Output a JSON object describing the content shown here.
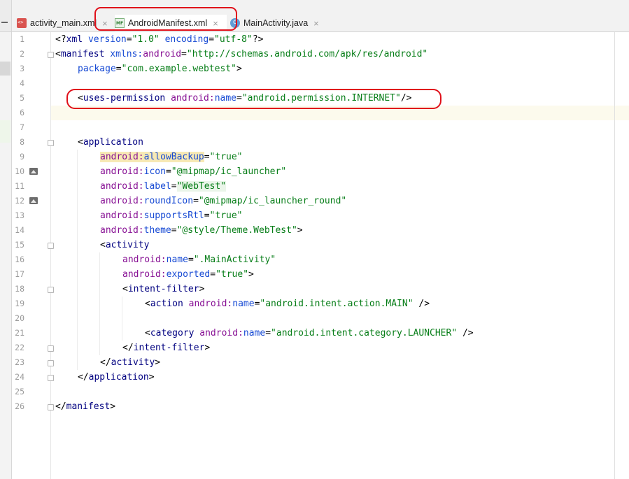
{
  "tabs": [
    {
      "label": "activity_main.xml",
      "icon": "xml-file-icon",
      "active": false
    },
    {
      "label": "AndroidManifest.xml",
      "icon": "manifest-file-icon",
      "active": true
    },
    {
      "label": "MainActivity.java",
      "icon": "java-class-icon",
      "active": false
    }
  ],
  "close_glyph": "×",
  "line_numbers": [
    "1",
    "2",
    "3",
    "4",
    "5",
    "6",
    "7",
    "8",
    "9",
    "10",
    "11",
    "12",
    "13",
    "14",
    "15",
    "16",
    "17",
    "18",
    "19",
    "20",
    "21",
    "22",
    "23",
    "24",
    "25",
    "26"
  ],
  "code": {
    "l1": {
      "a": "<?",
      "b": "xml",
      "c": " ",
      "d": "version",
      "e": "=",
      "f": "\"1.0\"",
      "g": " ",
      "h": "encoding",
      "i": "=",
      "j": "\"utf-8\"",
      "k": "?>"
    },
    "l2": {
      "a": "<",
      "b": "manifest",
      "c": " ",
      "d": "xmlns:",
      "e": "android",
      "f": "=",
      "g": "\"http://schemas.android.com/apk/res/android\""
    },
    "l3": {
      "a": "package",
      "b": "=",
      "c": "\"com.example.webtest\"",
      "d": ">"
    },
    "l5": {
      "a": "<",
      "b": "uses-permission",
      "c": " ",
      "d": "android:",
      "e": "name",
      "f": "=",
      "g": "\"android.permission.INTERNET\"",
      "h": "/>"
    },
    "l8": {
      "a": "<",
      "b": "application"
    },
    "l9": {
      "a": "android:",
      "b": "allowBackup",
      "c": "=",
      "d": "\"true\""
    },
    "l10": {
      "a": "android:",
      "b": "icon",
      "c": "=",
      "d": "\"@mipmap/ic_launcher\""
    },
    "l11": {
      "a": "android:",
      "b": "label",
      "c": "=",
      "d": "\"WebTest\""
    },
    "l12": {
      "a": "android:",
      "b": "roundIcon",
      "c": "=",
      "d": "\"@mipmap/ic_launcher_round\""
    },
    "l13": {
      "a": "android:",
      "b": "supportsRtl",
      "c": "=",
      "d": "\"true\""
    },
    "l14": {
      "a": "android:",
      "b": "theme",
      "c": "=",
      "d": "\"@style/Theme.WebTest\"",
      "e": ">"
    },
    "l15": {
      "a": "<",
      "b": "activity"
    },
    "l16": {
      "a": "android:",
      "b": "name",
      "c": "=",
      "d": "\".MainActivity\""
    },
    "l17": {
      "a": "android:",
      "b": "exported",
      "c": "=",
      "d": "\"true\"",
      "e": ">"
    },
    "l18": {
      "a": "<",
      "b": "intent-filter",
      "c": ">"
    },
    "l19": {
      "a": "<",
      "b": "action",
      "c": " ",
      "d": "android:",
      "e": "name",
      "f": "=",
      "g": "\"android.intent.action.MAIN\"",
      "h": " />"
    },
    "l21": {
      "a": "<",
      "b": "category",
      "c": " ",
      "d": "android:",
      "e": "name",
      "f": "=",
      "g": "\"android.intent.category.LAUNCHER\"",
      "h": " />"
    },
    "l22": {
      "a": "</",
      "b": "intent-filter",
      "c": ">"
    },
    "l23": {
      "a": "</",
      "b": "activity",
      "c": ">"
    },
    "l24": {
      "a": "</",
      "b": "application",
      "c": ">"
    },
    "l26": {
      "a": "</",
      "b": "manifest",
      "c": ">"
    }
  },
  "colors": {
    "tag": "#000080",
    "namespace": "#871094",
    "attribute": "#174ad4",
    "string": "#067d17",
    "annotation": "#e0101a",
    "current_line": "#fcfaed"
  }
}
